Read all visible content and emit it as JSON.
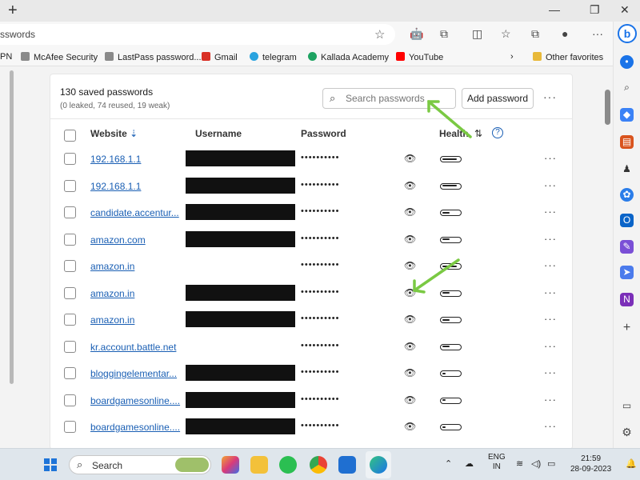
{
  "browser": {
    "address_text": "sswords",
    "sidebar_search_letter": "b"
  },
  "favorites": [
    {
      "label": "PN",
      "icon": "vpn-icon",
      "color": "#444444"
    },
    {
      "label": "McAfee Security",
      "icon": "document-icon",
      "color": "#777777"
    },
    {
      "label": "LastPass password...",
      "icon": "document-icon",
      "color": "#777777"
    },
    {
      "label": "Gmail",
      "icon": "gmail-icon",
      "color": "#d93025"
    },
    {
      "label": "telegram",
      "icon": "telegram-icon",
      "color": "#2aa3df"
    },
    {
      "label": "Kallada Academy",
      "icon": "kallada-icon",
      "color": "#1ea362"
    },
    {
      "label": "YouTube",
      "icon": "youtube-icon",
      "color": "#ff0000"
    }
  ],
  "other_favorites": "Other favorites",
  "passwords": {
    "count_label": "130 saved passwords",
    "summary": "(0 leaked, 74 reused, 19 weak)",
    "search_placeholder": "Search passwords",
    "add_button": "Add password",
    "more": "···",
    "columns": {
      "website": "Website",
      "username": "Username",
      "password": "Password",
      "health": "Health"
    },
    "masked": "••••••••••",
    "rows": [
      {
        "site": "192.168.1.1",
        "redacted": true,
        "health": 0.85
      },
      {
        "site": "192.168.1.1",
        "redacted": true,
        "health": 0.85
      },
      {
        "site": "candidate.accentur...",
        "redacted": true,
        "health": 0.45
      },
      {
        "site": "amazon.com",
        "redacted": true,
        "health": 0.45
      },
      {
        "site": "amazon.in",
        "redacted": false,
        "health": 0.85
      },
      {
        "site": "amazon.in",
        "redacted": true,
        "health": 0.45
      },
      {
        "site": "amazon.in",
        "redacted": true,
        "health": 0.45
      },
      {
        "site": "kr.account.battle.net",
        "redacted": false,
        "health": 0.45
      },
      {
        "site": "bloggingelementar...",
        "redacted": true,
        "health": 0.2
      },
      {
        "site": "boardgamesonline....",
        "redacted": true,
        "health": 0.2
      },
      {
        "site": "boardgamesonline....",
        "redacted": true,
        "health": 0.2
      }
    ]
  },
  "taskbar": {
    "search_label": "Search",
    "language_line1": "ENG",
    "language_line2": "IN",
    "time": "21:59",
    "date": "28-09-2023"
  }
}
